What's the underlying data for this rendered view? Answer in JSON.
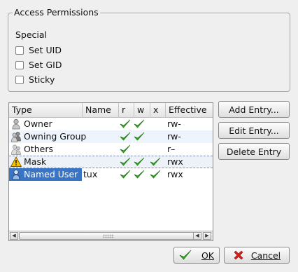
{
  "access_permissions": {
    "title": "Access Permissions",
    "special_label": "Special",
    "checkboxes": [
      {
        "label": "Set UID",
        "checked": false
      },
      {
        "label": "Set GID",
        "checked": false
      },
      {
        "label": "Sticky",
        "checked": false
      }
    ]
  },
  "acl_table": {
    "columns": [
      "Type",
      "Name",
      "r",
      "w",
      "x",
      "Effective"
    ],
    "rows": [
      {
        "type": "Owner",
        "icon": "user-icon",
        "name": "",
        "r": true,
        "w": true,
        "x": false,
        "effective": "rw-"
      },
      {
        "type": "Owning Group",
        "icon": "group-icon",
        "name": "",
        "r": true,
        "w": true,
        "x": false,
        "effective": "rw-"
      },
      {
        "type": "Others",
        "icon": "others-icon",
        "name": "",
        "r": true,
        "w": false,
        "x": false,
        "effective": "r–"
      },
      {
        "type": "Mask",
        "icon": "warning-icon",
        "name": "",
        "r": true,
        "w": true,
        "x": true,
        "effective": "rwx"
      },
      {
        "type": "Named User",
        "icon": "user-icon",
        "name": "tux",
        "r": true,
        "w": true,
        "x": true,
        "effective": "rwx",
        "selected": true
      }
    ]
  },
  "side_buttons": {
    "add_entry": {
      "label": "Add Entry...",
      "mnemonic": "A"
    },
    "edit_entry": {
      "label": "Edit Entry...",
      "mnemonic": "E"
    },
    "delete_entry": {
      "label": "Delete Entry",
      "mnemonic": ""
    }
  },
  "dialog_buttons": {
    "ok": {
      "label": "OK",
      "icon": "checkmark-icon"
    },
    "cancel": {
      "label": "Cancel",
      "icon": "cancel-x-icon"
    }
  },
  "colors": {
    "selection": "#3a74c5",
    "check_green": "#2fae1e",
    "cancel_red": "#d2201c",
    "warning_yellow": "#f5c400"
  }
}
